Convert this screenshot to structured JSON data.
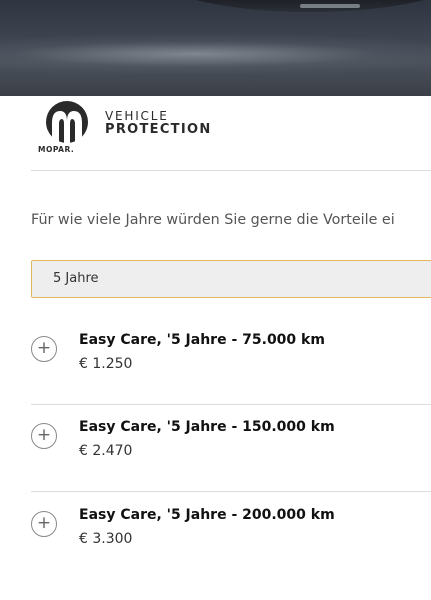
{
  "hero": {
    "image": "car-on-road-photo"
  },
  "logo": {
    "icon": "mopar-m-icon",
    "brand": "MOPAR.",
    "line1": "VEHICLE",
    "line2": "PROTECTION",
    "color": "#2a2a2a"
  },
  "question": "Für wie viele Jahre würden Sie gerne die Vorteile ei",
  "select": {
    "value": "5 Jahre",
    "border_color": "#e0b75a"
  },
  "options": [
    {
      "title": "Easy Care, '5 Jahre - 75.000 km",
      "price": "€ 1.250",
      "icon": "plus-circle-icon"
    },
    {
      "title": "Easy Care, '5 Jahre - 150.000 km",
      "price": "€ 2.470",
      "icon": "plus-circle-icon"
    },
    {
      "title": "Easy Care, '5 Jahre - 200.000 km",
      "price": "€ 3.300",
      "icon": "plus-circle-icon"
    }
  ]
}
